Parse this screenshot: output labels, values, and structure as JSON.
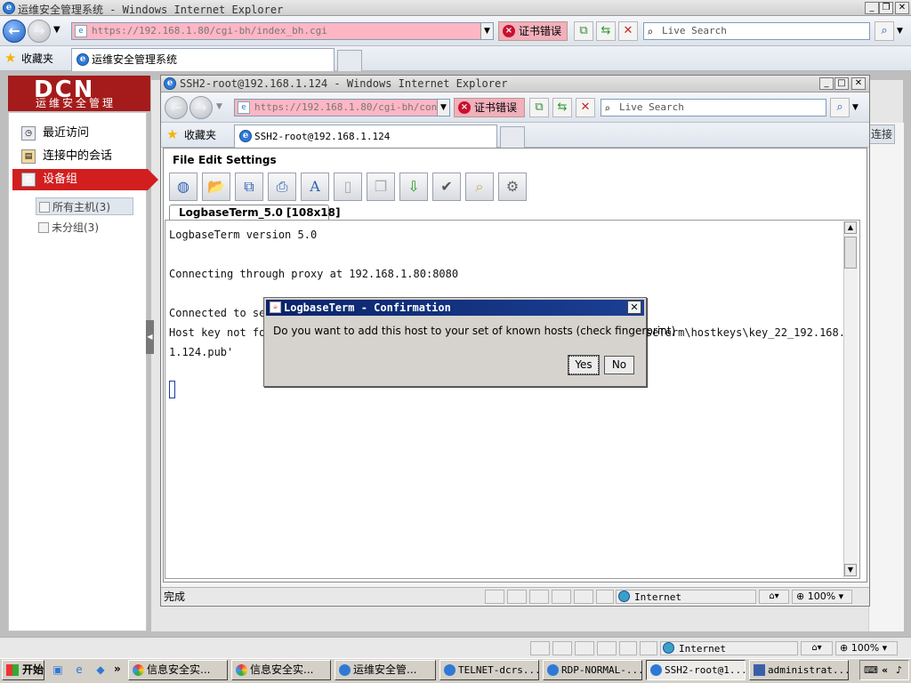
{
  "outer": {
    "title": "运维安全管理系统 - Windows Internet Explorer",
    "url": "https://192.168.1.80/cgi-bh/index_bh.cgi",
    "cert_error": "证书错误",
    "search_placeholder": "Live Search",
    "favorites_label": "收藏夹",
    "tab_label": "运维安全管理系统",
    "status_zone": "Internet",
    "zoom": "100%"
  },
  "page": {
    "logo": "DCN",
    "logo_sub": "运维安全管理",
    "menu": [
      {
        "label": "最近访问"
      },
      {
        "label": "连接中的会话"
      },
      {
        "label": "设备组"
      }
    ],
    "tree": [
      {
        "label": "所有主机(3)"
      },
      {
        "label": "未分组(3)"
      }
    ],
    "connect_fragment": "连接"
  },
  "inner": {
    "title": "SSH2-root@192.168.1.124 - Windows Internet Explorer",
    "url": "https://192.168.1.80/cgi-bh/contro",
    "cert_error": "证书错误",
    "search_placeholder": "Live Search",
    "favorites_label": "收藏夹",
    "tab_label": "SSH2-root@192.168.1.124",
    "status_done": "完成",
    "status_zone": "Internet",
    "zoom": "100%"
  },
  "applet": {
    "menus": [
      "File",
      "Edit",
      "Settings"
    ],
    "toolbar_icons": [
      "globe-icon",
      "open-folder-icon",
      "copy-screen-icon",
      "print-icon",
      "font-icon",
      "blank-doc-icon",
      "copy-doc-icon",
      "import-icon",
      "check-icon",
      "search-icon",
      "settings-gears-icon"
    ],
    "tab_label": "LogbaseTerm_5.0 [108x18]",
    "lines": [
      "LogbaseTerm version 5.0",
      "Connecting through proxy at 192.168.1.80:8080",
      "Connected to se",
      "Host key not fo",
      "1.124.pub'"
    ],
    "line4_tail": "seTerm\\hostkeys\\key_22_192.168."
  },
  "dialog": {
    "title": "LogbaseTerm - Confirmation",
    "message": "Do you want to add this host to your set of known hosts (check fingerprint)",
    "yes": "Yes",
    "no": "No"
  },
  "taskbar": {
    "start": "开始",
    "overflow": "»",
    "tasks": [
      {
        "label": "信息安全实..."
      },
      {
        "label": "信息安全实..."
      },
      {
        "label": "运维安全管..."
      },
      {
        "label": "TELNET-dcrs..."
      },
      {
        "label": "RDP-NORMAL-..."
      },
      {
        "label": "SSH2-root@1..."
      },
      {
        "label": "administrat..."
      }
    ]
  },
  "colors": {
    "dcn_red": "#d21e1e",
    "cert_pink": "#ffb6c4",
    "dialog_title": "#0a246a"
  }
}
